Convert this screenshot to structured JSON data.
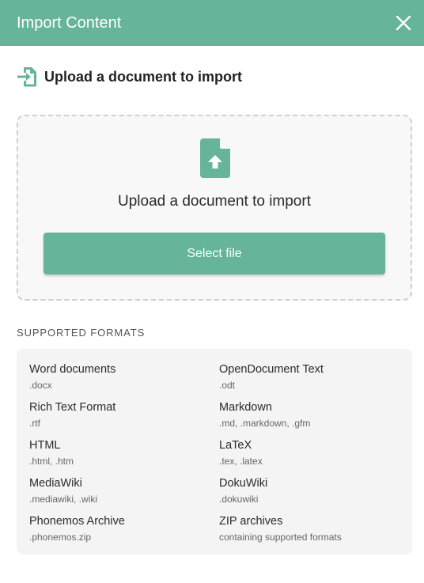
{
  "header": {
    "title": "Import Content"
  },
  "upload": {
    "heading": "Upload a document to import",
    "prompt": "Upload a document to import",
    "button_label": "Select file"
  },
  "formats": {
    "label": "SUPPORTED FORMATS",
    "items": [
      {
        "name": "Word documents",
        "ext": ".docx"
      },
      {
        "name": "OpenDocument Text",
        "ext": ".odt"
      },
      {
        "name": "Rich Text Format",
        "ext": ".rtf"
      },
      {
        "name": "Markdown",
        "ext": ".md, .markdown, .gfm"
      },
      {
        "name": "HTML",
        "ext": ".html, .htm"
      },
      {
        "name": "LaTeX",
        "ext": ".tex, .latex"
      },
      {
        "name": "MediaWiki",
        "ext": ".mediawiki, .wiki"
      },
      {
        "name": "DokuWiki",
        "ext": ".dokuwiki"
      },
      {
        "name": "Phonemos Archive",
        "ext": ".phonemos.zip"
      },
      {
        "name": "ZIP archives",
        "ext": "containing supported formats"
      }
    ]
  },
  "colors": {
    "accent": "#66b49a",
    "header_text": "#ffffff"
  },
  "icons": [
    "close-icon",
    "import-icon",
    "file-upload-icon"
  ]
}
